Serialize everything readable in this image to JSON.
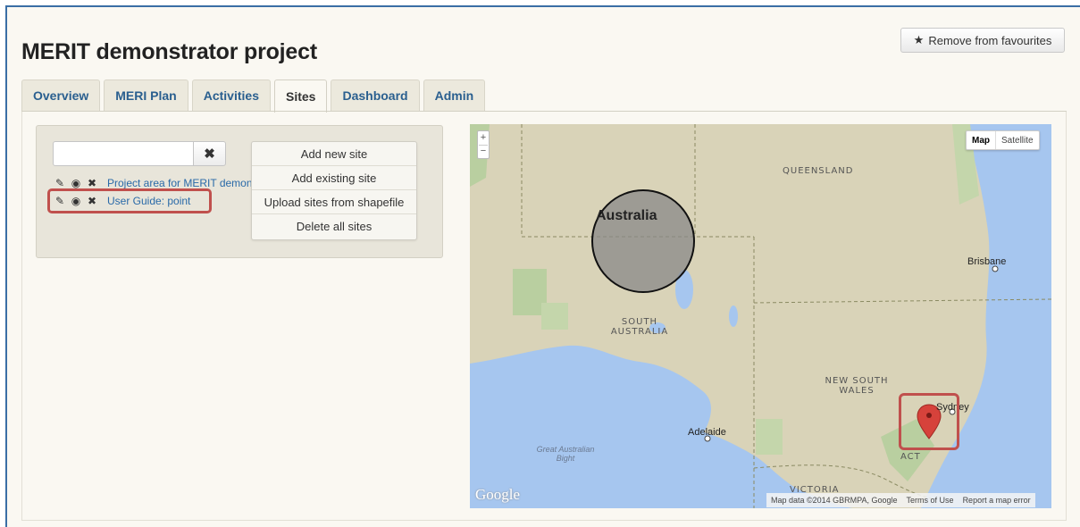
{
  "project": {
    "title": "MERIT demonstrator project",
    "favourite_button": "Remove from favourites",
    "favourite_icon": "star-icon"
  },
  "tabs": [
    {
      "label": "Overview",
      "active": false
    },
    {
      "label": "MERI Plan",
      "active": false
    },
    {
      "label": "Activities",
      "active": false
    },
    {
      "label": "Sites",
      "active": true
    },
    {
      "label": "Dashboard",
      "active": false
    },
    {
      "label": "Admin",
      "active": false
    }
  ],
  "sites": {
    "search": {
      "value": "",
      "clear_icon": "close-icon"
    },
    "list": [
      {
        "label": "Project area for MERIT demonstrator project",
        "icons": [
          "edit-icon",
          "view-icon",
          "delete-icon"
        ]
      },
      {
        "label": "User Guide: point",
        "icons": [
          "edit-icon",
          "view-icon",
          "delete-icon"
        ]
      }
    ],
    "actions": [
      "Add new site",
      "Add existing site",
      "Upload sites from shapefile",
      "Delete all sites"
    ]
  },
  "map": {
    "zoom_in": "+",
    "zoom_out": "−",
    "map_types": [
      "Map",
      "Satellite"
    ],
    "selected_type": "Map",
    "labels": {
      "queensland": "QUEENSLAND",
      "australia": "Australia",
      "south_australia": "SOUTH AUSTRALIA",
      "new_south_wales": "NEW SOUTH WALES",
      "victoria": "VICTORIA",
      "act": "ACT",
      "brisbane": "Brisbane",
      "sydney": "Sydney",
      "adelaide": "Adelaide",
      "great_australian_bight": "Great Australian Bight"
    },
    "logo": "Google",
    "attribution": [
      "Map data ©2014 GBRMPA, Google",
      "Terms of Use",
      "Report a map error"
    ],
    "colors": {
      "land": "#d9d3b8",
      "water": "#a6c6ef",
      "park": "#b9cfa0",
      "circle": "#888888",
      "marker": "#d6423b",
      "highlight": "#c0504d"
    }
  }
}
